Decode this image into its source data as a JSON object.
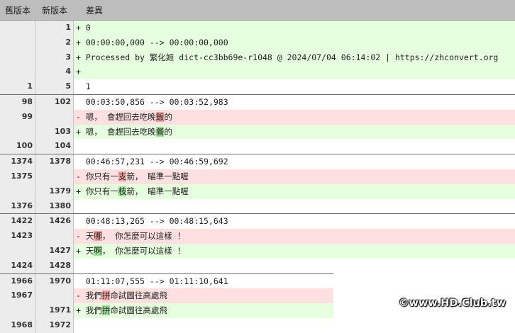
{
  "header": {
    "old_version": "舊版本",
    "new_version": "新版本",
    "diff": "差異"
  },
  "rows": [
    {
      "type": "add",
      "old": "",
      "new": "1",
      "sign": "+",
      "segments": [
        {
          "text": "0"
        }
      ]
    },
    {
      "type": "add",
      "old": "",
      "new": "2",
      "sign": "+",
      "segments": [
        {
          "text": "00:00:00,000 --> 00:00:00,000"
        }
      ]
    },
    {
      "type": "add",
      "old": "",
      "new": "3",
      "sign": "+",
      "segments": [
        {
          "text": "Processed by 繁化姬 dict-cc3bb69e-r1048 @ 2024/07/04 06:14:02 | https://zhconvert.org"
        }
      ]
    },
    {
      "type": "add",
      "old": "",
      "new": "4",
      "sign": "+",
      "segments": [
        {
          "text": ""
        }
      ]
    },
    {
      "type": "ctx",
      "old": "1",
      "new": "5",
      "sign": " ",
      "segments": [
        {
          "text": "1"
        }
      ]
    },
    {
      "type": "ctx",
      "sep": true,
      "old": "98",
      "new": "102",
      "sign": " ",
      "segments": [
        {
          "text": "00:03:50,856 --> 00:03:52,983"
        }
      ]
    },
    {
      "type": "del",
      "old": "99",
      "new": "",
      "sign": "-",
      "segments": [
        {
          "text": "嗯， 會趕回去吃晚"
        },
        {
          "text": "飯",
          "hl": true
        },
        {
          "text": "的"
        }
      ]
    },
    {
      "type": "add",
      "old": "",
      "new": "103",
      "sign": "+",
      "segments": [
        {
          "text": "嗯， 會趕回去吃晚"
        },
        {
          "text": "餐",
          "hl": true
        },
        {
          "text": "的"
        }
      ]
    },
    {
      "type": "ctx",
      "old": "100",
      "new": "104",
      "sign": " ",
      "segments": [
        {
          "text": ""
        }
      ]
    },
    {
      "type": "ctx",
      "sep": true,
      "old": "1374",
      "new": "1378",
      "sign": " ",
      "segments": [
        {
          "text": "00:46:57,231 --> 00:46:59,692"
        }
      ]
    },
    {
      "type": "del",
      "old": "1375",
      "new": "",
      "sign": "-",
      "segments": [
        {
          "text": "你只有一"
        },
        {
          "text": "支",
          "hl": true
        },
        {
          "text": "箭， 瞄準一點喔"
        }
      ]
    },
    {
      "type": "add",
      "old": "",
      "new": "1379",
      "sign": "+",
      "segments": [
        {
          "text": "你只有一"
        },
        {
          "text": "枝",
          "hl": true
        },
        {
          "text": "箭， 瞄準一點喔"
        }
      ]
    },
    {
      "type": "ctx",
      "old": "1376",
      "new": "1380",
      "sign": " ",
      "segments": [
        {
          "text": ""
        }
      ]
    },
    {
      "type": "ctx",
      "sep": true,
      "old": "1422",
      "new": "1426",
      "sign": " ",
      "segments": [
        {
          "text": "00:48:13,265 --> 00:48:15,643"
        }
      ]
    },
    {
      "type": "del",
      "old": "1423",
      "new": "",
      "sign": "-",
      "segments": [
        {
          "text": "天"
        },
        {
          "text": "哪",
          "hl": true
        },
        {
          "text": "， 你怎麼可以這樣 ！"
        }
      ]
    },
    {
      "type": "add",
      "old": "",
      "new": "1427",
      "sign": "+",
      "segments": [
        {
          "text": "天"
        },
        {
          "text": "啊",
          "hl": true
        },
        {
          "text": "， 你怎麼可以這樣 ！"
        }
      ]
    },
    {
      "type": "ctx",
      "old": "1424",
      "new": "1428",
      "sign": " ",
      "segments": [
        {
          "text": ""
        }
      ]
    },
    {
      "type": "ctx",
      "sep": true,
      "old": "1966",
      "new": "1970",
      "sign": " ",
      "segments": [
        {
          "text": "01:11:07,555 --> 01:11:10,641"
        }
      ]
    },
    {
      "type": "del",
      "old": "1967",
      "new": "",
      "sign": "-",
      "segments": [
        {
          "text": "我們"
        },
        {
          "text": "拼",
          "hl": true
        },
        {
          "text": "命試圖往高處飛"
        }
      ]
    },
    {
      "type": "add",
      "old": "",
      "new": "1971",
      "sign": "+",
      "segments": [
        {
          "text": "我們"
        },
        {
          "text": "拚",
          "hl": true
        },
        {
          "text": "命試圖往高處飛"
        }
      ]
    },
    {
      "type": "ctx",
      "old": "1968",
      "new": "1972",
      "sign": " ",
      "segments": [
        {
          "text": ""
        }
      ]
    }
  ],
  "watermark": "©www.HD.Club.tw"
}
